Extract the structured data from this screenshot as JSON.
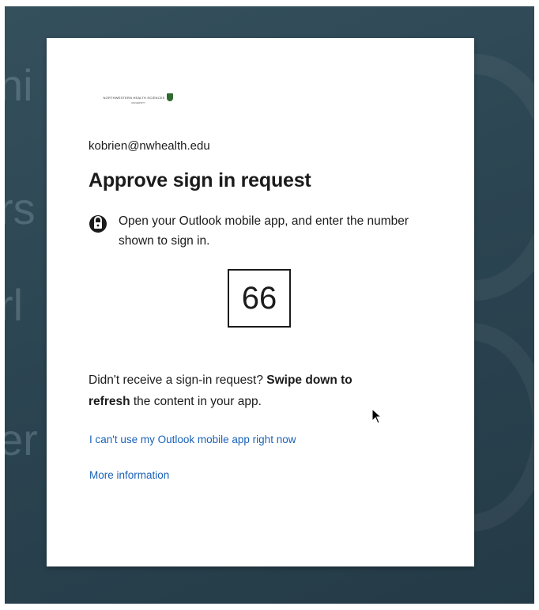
{
  "logo": {
    "org_name": "NORTHWESTERN HEALTH SCIENCES",
    "org_sub": "UNIVERSITY"
  },
  "account": {
    "email": "kobrien@nwhealth.edu"
  },
  "dialog": {
    "title": "Approve sign in request",
    "instruction": "Open your Outlook mobile app, and enter the number shown to sign in.",
    "number": "66",
    "refresh_prefix": "Didn't receive a sign-in request? ",
    "refresh_bold_1": "Swipe down to",
    "refresh_bold_2": "refresh",
    "refresh_suffix": " the content in your app."
  },
  "links": {
    "cant_use_app": "I can't use my Outlook mobile app right now",
    "more_info": "More information"
  },
  "background": {
    "letters": [
      "ni",
      "rs",
      "rl",
      "er"
    ]
  },
  "icons": {
    "lock": "lock-icon",
    "cursor": "mouse-cursor-icon"
  },
  "colors": {
    "link": "#1a62b8",
    "text": "#1b1b1b",
    "backdrop": "#2c4552",
    "logo_shield": "#2f6b2f"
  }
}
